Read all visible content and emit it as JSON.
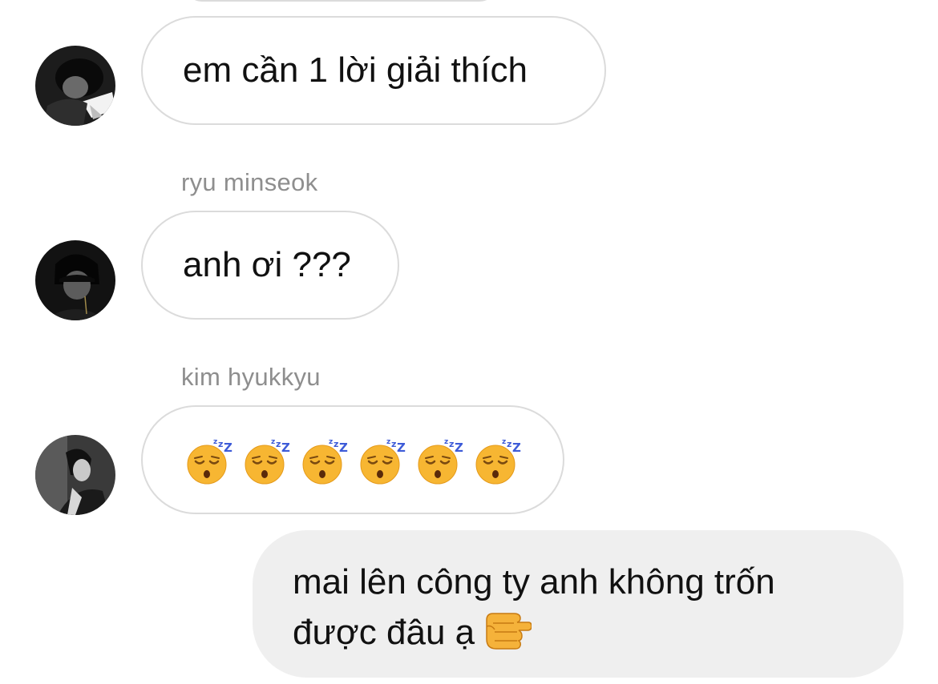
{
  "messages": [
    {
      "sender": "",
      "avatar_icon": "user-avatar-1",
      "text": "em cần 1 lời giải thích"
    },
    {
      "sender": "ryu minseok",
      "avatar_icon": "user-avatar-2",
      "text": "anh ơi ???"
    },
    {
      "sender": "kim hyukkyu",
      "avatar_icon": "user-avatar-3",
      "emoji": [
        "sleeping-face-icon",
        "sleeping-face-icon",
        "sleeping-face-icon",
        "sleeping-face-icon",
        "sleeping-face-icon",
        "sleeping-face-icon"
      ]
    }
  ],
  "outgoing": {
    "text": "mai lên công ty anh không trốn được đâu ạ",
    "emoji": "pointing-fist-icon"
  },
  "colors": {
    "incoming_border": "#dbdbdb",
    "outgoing_bg": "#efefef",
    "sender_name": "#8e8e8e",
    "text": "#111111"
  }
}
